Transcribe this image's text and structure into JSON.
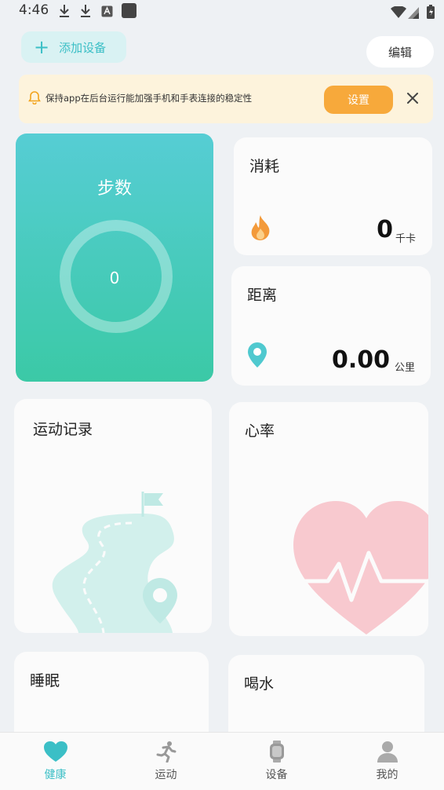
{
  "status_bar": {
    "time": "4:46"
  },
  "header": {
    "add_device_label": "添加设备",
    "edit_label": "编辑"
  },
  "notice": {
    "text": "保持app在后台运行能加强手机和手表连接的稳定性",
    "button_label": "设置"
  },
  "cards": {
    "steps": {
      "title": "步数",
      "value": "0"
    },
    "calories": {
      "title": "消耗",
      "value": "0",
      "unit": "千卡"
    },
    "distance": {
      "title": "距离",
      "value": "0.00",
      "unit": "公里"
    },
    "sport_records": {
      "title": "运动记录"
    },
    "heart_rate": {
      "title": "心率"
    },
    "sleep": {
      "title": "睡眠"
    },
    "water": {
      "title": "喝水"
    }
  },
  "bottom_nav": {
    "items": [
      {
        "label": "健康",
        "icon": "heart-icon",
        "active": true
      },
      {
        "label": "运动",
        "icon": "running-icon",
        "active": false
      },
      {
        "label": "设备",
        "icon": "watch-icon",
        "active": false
      },
      {
        "label": "我的",
        "icon": "user-icon",
        "active": false
      }
    ]
  },
  "colors": {
    "accent": "#3bbfc6",
    "steps_gradient_top": "#56cdd4",
    "steps_gradient_bottom": "#3bc9a6",
    "notice_bg": "#fdf3dc",
    "notice_button": "#f7a93b",
    "flame": "#f39a3a",
    "heart_pink": "#f8c9cf"
  }
}
